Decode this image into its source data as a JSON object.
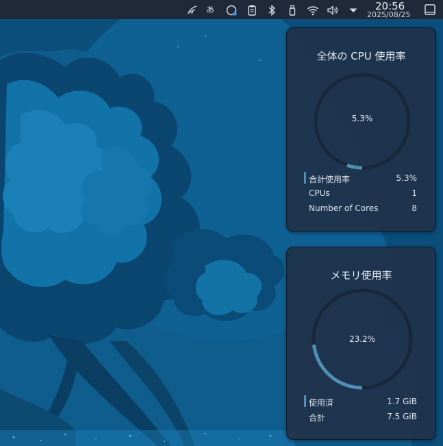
{
  "panel": {
    "clock_time": "20:56",
    "clock_date": "2025/08/25",
    "ime_label": "あ",
    "icons": [
      "kde-connect-icon",
      "input-method-icon",
      "update-icon",
      "clipboard-icon",
      "bluetooth-icon",
      "usb-drive-icon",
      "wifi-icon",
      "volume-icon",
      "tray-expand-icon",
      "show-desktop-icon"
    ]
  },
  "cpu": {
    "title": "全体の CPU 使用率",
    "value_text": "5.3%",
    "fraction": 0.053,
    "rows": [
      {
        "label": "合計使用率",
        "value": "5.3%"
      },
      {
        "label": "CPUs",
        "value": "1"
      },
      {
        "label": "Number of Cores",
        "value": "8"
      }
    ]
  },
  "memory": {
    "title": "メモリ使用率",
    "value_text": "23.2%",
    "fraction": 0.232,
    "rows": [
      {
        "label": "使用済",
        "value": "1.7 GiB"
      },
      {
        "label": "合計",
        "value": "7.5 GiB"
      }
    ]
  },
  "colors": {
    "panel_bg": "#1f2939",
    "widget_bg": "#1f324a",
    "gauge_track": "#18283a",
    "gauge_fill": "#4f8fb8",
    "wallpaper": "#0d5b8a"
  }
}
